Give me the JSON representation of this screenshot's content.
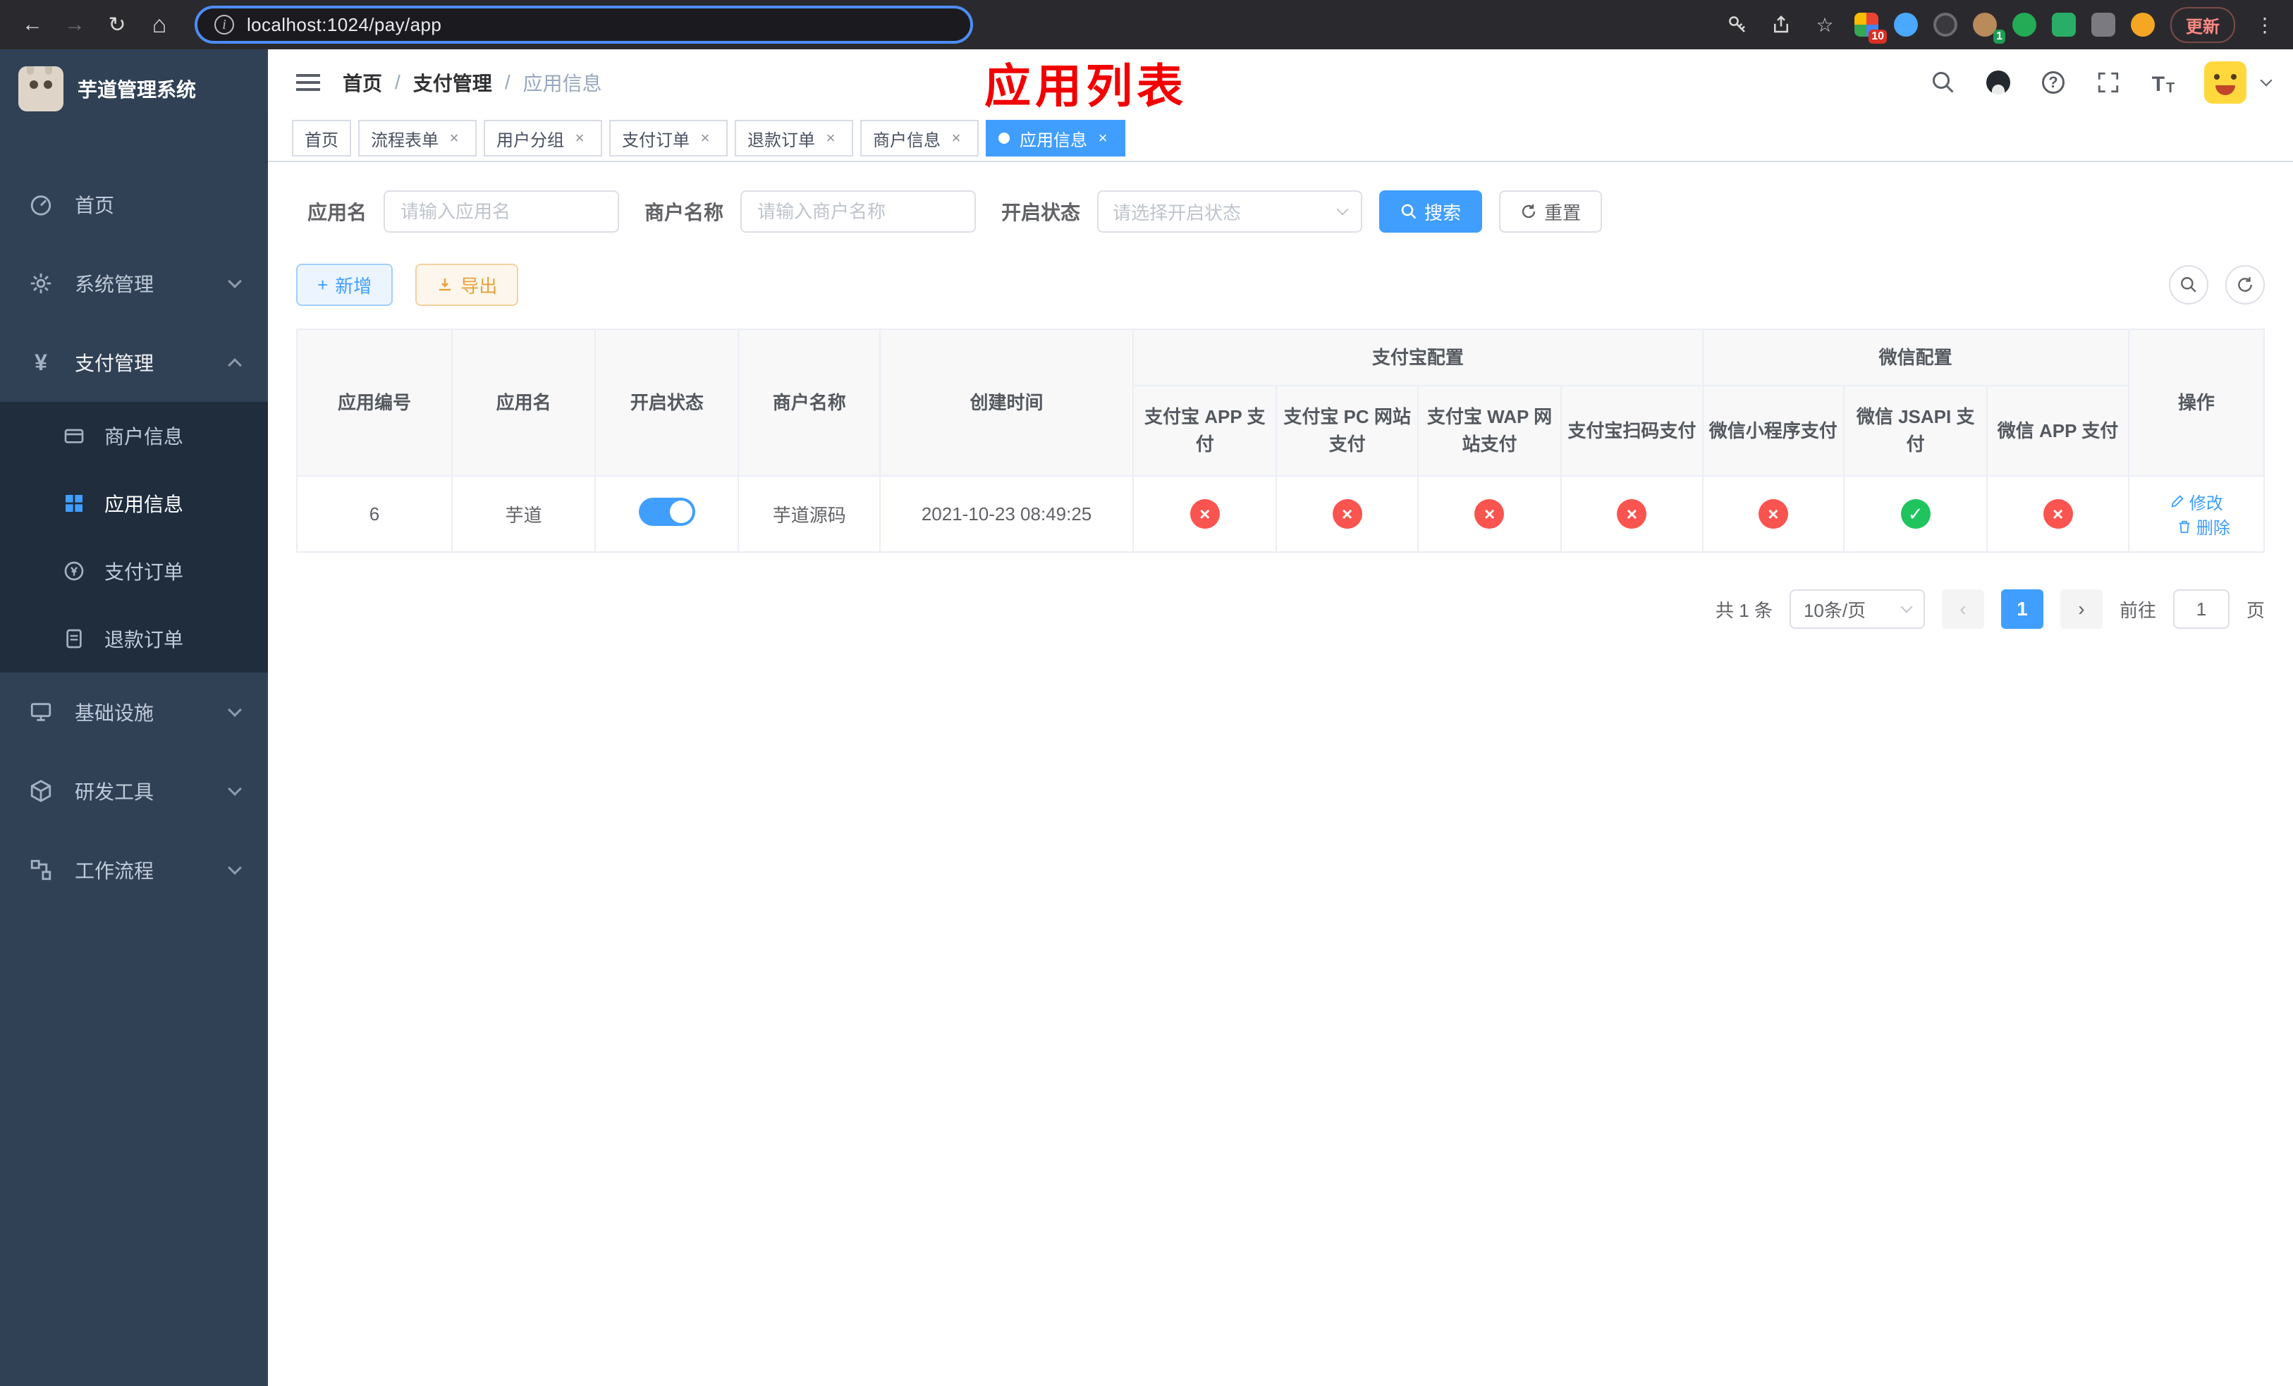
{
  "colors": {
    "accent": "#409eff",
    "danger": "#f9544f",
    "success": "#1fc45f",
    "sidebar_bg": "#304156",
    "submenu_bg": "#1f2d3d",
    "annotation_red": "#f20000"
  },
  "browser": {
    "url": "localhost:1024/pay/app",
    "update_label": "更新",
    "extension_badges": {
      "grid": "10",
      "avatar": "1"
    }
  },
  "sidebar": {
    "title": "芋道管理系统",
    "items": [
      {
        "label": "首页"
      },
      {
        "label": "系统管理"
      },
      {
        "label": "支付管理",
        "children": [
          {
            "label": "商户信息"
          },
          {
            "label": "应用信息"
          },
          {
            "label": "支付订单"
          },
          {
            "label": "退款订单"
          }
        ]
      },
      {
        "label": "基础设施"
      },
      {
        "label": "研发工具"
      },
      {
        "label": "工作流程"
      }
    ]
  },
  "navbar": {
    "breadcrumb": [
      "首页",
      "支付管理",
      "应用信息"
    ],
    "separator": "/",
    "annotation": "应用列表"
  },
  "tabs": [
    {
      "label": "首页"
    },
    {
      "label": "流程表单"
    },
    {
      "label": "用户分组"
    },
    {
      "label": "支付订单"
    },
    {
      "label": "退款订单"
    },
    {
      "label": "商户信息"
    },
    {
      "label": "应用信息"
    }
  ],
  "filters": {
    "app_name": {
      "label": "应用名",
      "placeholder": "请输入应用名"
    },
    "merchant_name": {
      "label": "商户名称",
      "placeholder": "请输入商户名称"
    },
    "status": {
      "label": "开启状态",
      "placeholder": "请选择开启状态"
    },
    "search": "搜索",
    "reset": "重置"
  },
  "toolbar": {
    "add": "新增",
    "export": "导出"
  },
  "table": {
    "columns_simple": [
      "应用编号",
      "应用名",
      "开启状态",
      "商户名称",
      "创建时间"
    ],
    "group_alipay": "支付宝配置",
    "group_wechat": "微信配置",
    "columns_alipay": [
      "支付宝 APP 支付",
      "支付宝 PC 网站支付",
      "支付宝 WAP 网站支付",
      "支付宝扫码支付"
    ],
    "columns_wechat": [
      "微信小程序支付",
      "微信 JSAPI 支付",
      "微信 APP 支付"
    ],
    "column_actions": "操作",
    "rows": [
      {
        "id": "6",
        "name": "芋道",
        "enabled": true,
        "merchant": "芋道源码",
        "created_at": "2021-10-23 08:49:25",
        "statuses": [
          false,
          false,
          false,
          false,
          false,
          true,
          false
        ],
        "edit": "修改",
        "delete": "删除"
      }
    ]
  },
  "pagination": {
    "total": "共 1 条",
    "page_size": "10条/页",
    "page": "1",
    "goto_label": "前往",
    "goto_value": "1",
    "unit": "页"
  }
}
